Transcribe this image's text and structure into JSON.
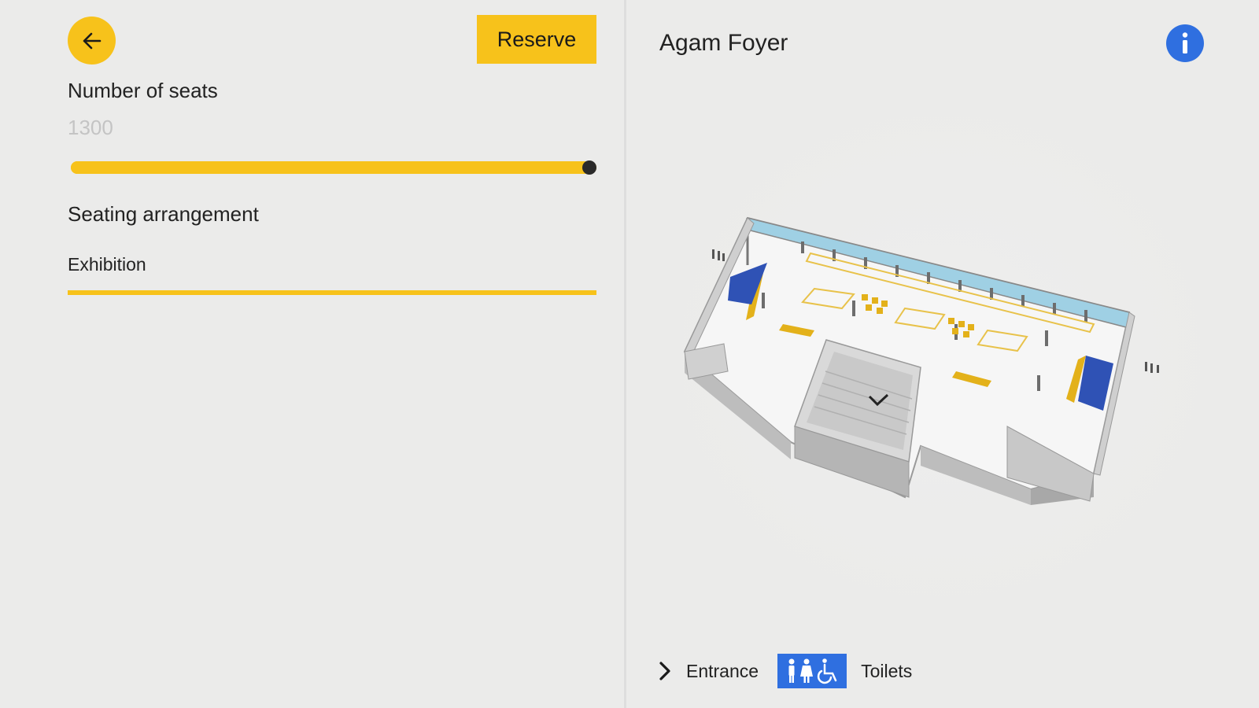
{
  "colors": {
    "accent": "#f7c21b",
    "info_blue": "#2f6fe0",
    "background": "#ebebea",
    "slider_thumb": "#2a2a2a",
    "muted_text": "#c4c4c4"
  },
  "header": {
    "back_icon": "arrow-left-icon",
    "reserve_label": "Reserve"
  },
  "seats": {
    "label": "Number of seats",
    "value": "1300",
    "slider_fraction": 1.0
  },
  "arrangement": {
    "label": "Seating arrangement",
    "selected": "Exhibition"
  },
  "venue": {
    "title": "Agam Foyer",
    "info_icon": "info-icon",
    "map_icon": "floor-plan-3d-image"
  },
  "legend": {
    "entrance_icon": "chevron-right-icon",
    "entrance_label": "Entrance",
    "toilets_icon": "toilets-icon",
    "toilets_label": "Toilets"
  }
}
